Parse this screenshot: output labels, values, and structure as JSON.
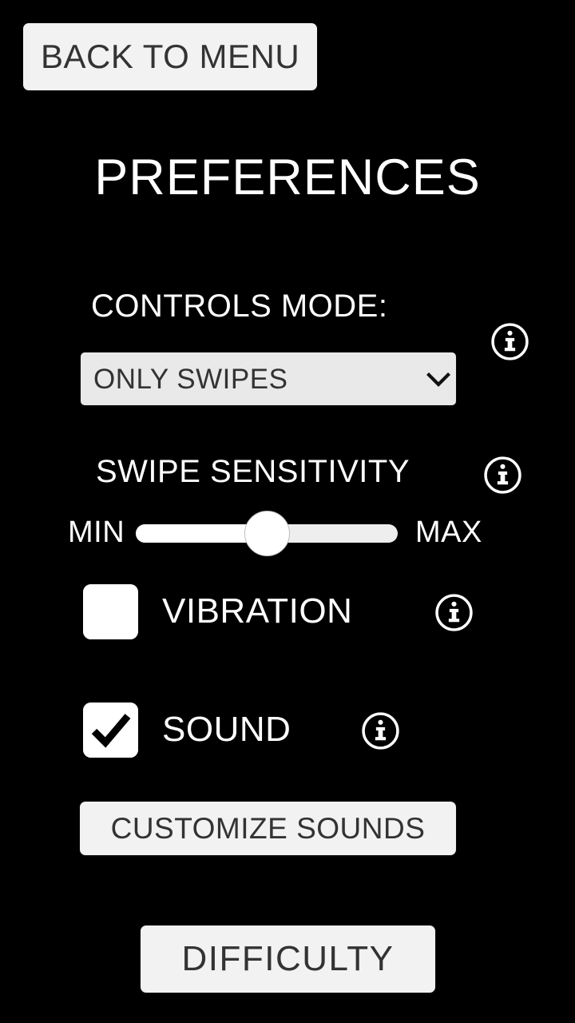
{
  "screen": {
    "background_color": "#000000",
    "title": "PREFERENCES"
  },
  "nav": {
    "back_label": "BACK TO MENU"
  },
  "controls_mode": {
    "label": "CONTROLS MODE:",
    "selected": "ONLY SWIPES",
    "options": [
      "ONLY SWIPES"
    ],
    "info_icon": "info-icon",
    "chevron_icon": "chevron-down-icon"
  },
  "swipe_sensitivity": {
    "label": "SWIPE SENSITIVITY",
    "min_label": "MIN",
    "max_label": "MAX",
    "value_percent": 50,
    "info_icon": "info-icon"
  },
  "vibration": {
    "label": "VIBRATION",
    "checked": false,
    "info_icon": "info-icon",
    "checkbox_icon": "checkbox-unchecked-icon"
  },
  "sound": {
    "label": "SOUND",
    "checked": true,
    "info_icon": "info-icon",
    "checkbox_icon": "checkbox-checked-icon"
  },
  "buttons": {
    "customize_sounds": "CUSTOMIZE SOUNDS",
    "difficulty": "DIFFICULTY"
  },
  "colors": {
    "background": "#000000",
    "button_face": "#f2f2f2",
    "button_text": "#333333",
    "select_face": "#e9e9e9",
    "accent_white": "#ffffff"
  }
}
